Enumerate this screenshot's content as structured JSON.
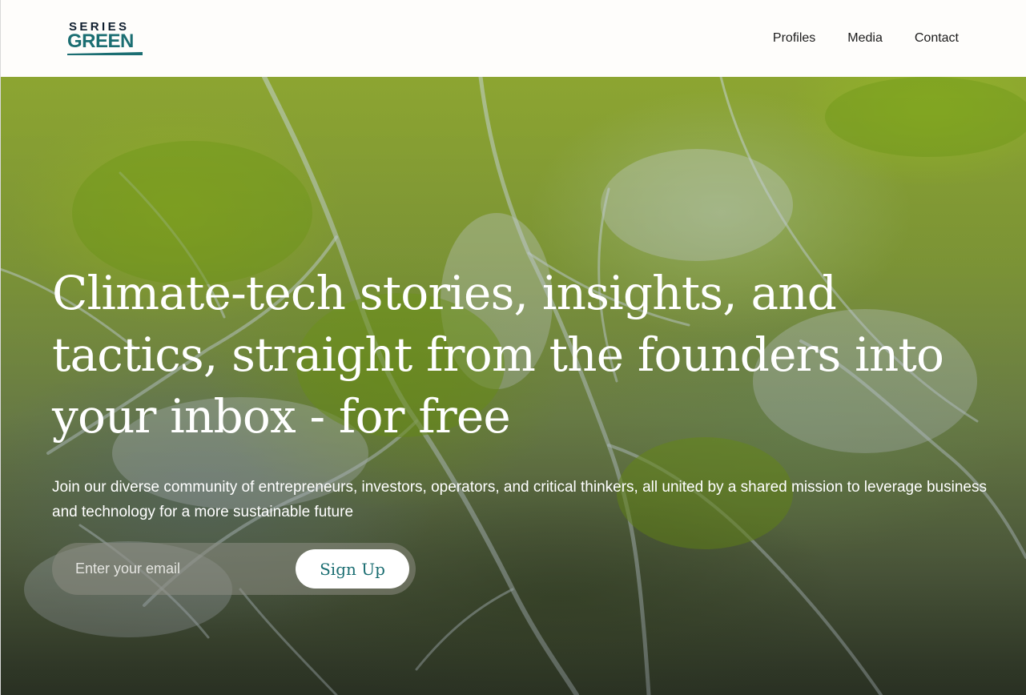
{
  "brand": {
    "logo_top": "SERIES",
    "logo_bottom": "GREEN",
    "colors": {
      "logo_dark": "#0f1e2e",
      "logo_teal": "#1b6e72"
    }
  },
  "nav": {
    "items": [
      {
        "label": "Profiles"
      },
      {
        "label": "Media"
      },
      {
        "label": "Contact"
      }
    ]
  },
  "hero": {
    "background": "aerial-mangrove-forest-photo",
    "headline": "Climate-tech stories, insights, and tactics, straight from the founders into your inbox - for free",
    "subtext": "Join our diverse community of entrepreneurs, investors, operators, and critical thinkers, all united by a shared mission to leverage business and technology for a more sustainable future",
    "form": {
      "email_placeholder": "Enter your email",
      "email_value": "",
      "button_label": "Sign Up"
    }
  }
}
